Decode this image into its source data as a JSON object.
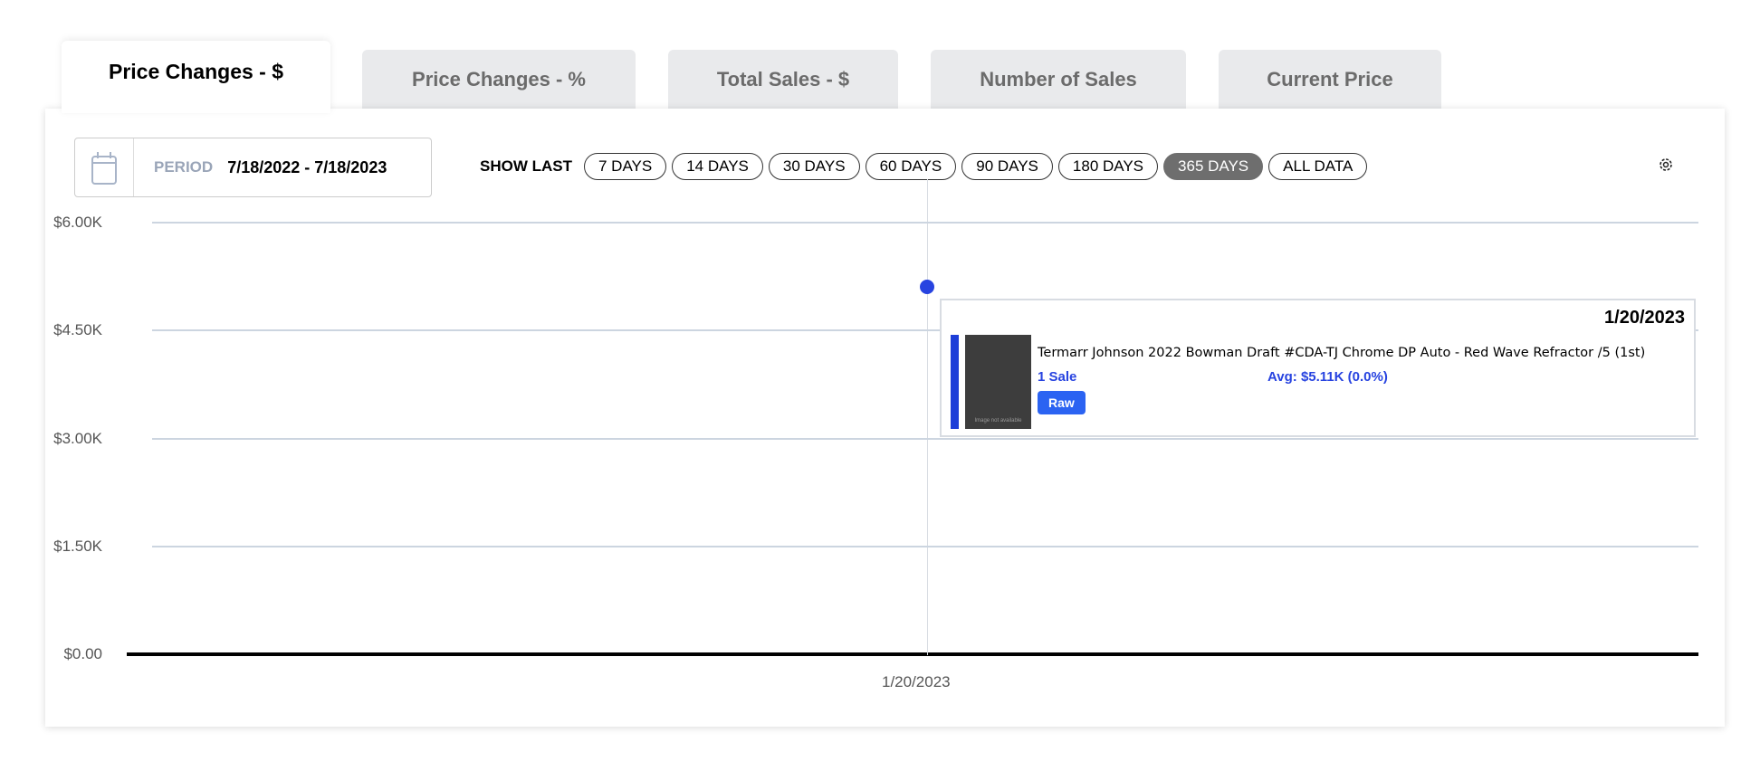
{
  "tabs": [
    {
      "label": "Price Changes - $",
      "active": true
    },
    {
      "label": "Price Changes - %"
    },
    {
      "label": "Total Sales - $"
    },
    {
      "label": "Number of Sales"
    },
    {
      "label": "Current Price"
    }
  ],
  "period": {
    "label": "PERIOD",
    "value": "7/18/2022 - 7/18/2023",
    "icon": "calendar-icon"
  },
  "show_last": {
    "label": "SHOW LAST",
    "options": [
      "7 DAYS",
      "14 DAYS",
      "30 DAYS",
      "60 DAYS",
      "90 DAYS",
      "180 DAYS",
      "365 DAYS",
      "ALL DATA"
    ],
    "selected": "365 DAYS"
  },
  "settings_icon": "gear-icon",
  "chart_data": {
    "type": "scatter",
    "x": [
      "1/20/2023"
    ],
    "values": [
      5110
    ],
    "ylim": [
      0,
      6000
    ],
    "yticks": [
      "$0.00",
      "$1.50K",
      "$3.00K",
      "$4.50K",
      "$6.00K"
    ],
    "xticks": [
      "1/20/2023"
    ],
    "grid": true,
    "point_color": "#2743e0"
  },
  "tooltip": {
    "date": "1/20/2023",
    "title": "Termarr Johnson 2022 Bowman Draft #CDA-TJ Chrome DP Auto - Red Wave Refractor /5 (1st)",
    "sales": "1 Sale",
    "avg": "Avg: $5.11K (0.0%)",
    "badge": "Raw",
    "image_text": "Image not available"
  }
}
